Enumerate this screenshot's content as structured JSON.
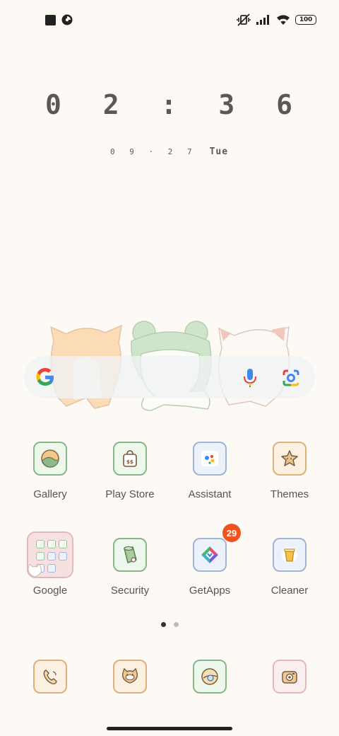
{
  "status_bar": {
    "battery_level": "100",
    "icons": [
      "notification-square-icon",
      "pie-app-icon",
      "vibrate-off-icon",
      "signal-icon",
      "wifi-icon",
      "battery-icon"
    ]
  },
  "clock": {
    "time": "0 2 : 3 6",
    "date": "0 9 · 2 7",
    "day": "Tue"
  },
  "search_bar": {
    "icons": [
      "google-logo-icon",
      "microphone-icon",
      "google-lens-icon"
    ]
  },
  "apps": [
    {
      "label": "Gallery",
      "icon": "gallery-icon",
      "border": "#88b887",
      "bg": "#eef7ec"
    },
    {
      "label": "Play Store",
      "icon": "play-store-icon",
      "border": "#88b887",
      "bg": "#eef7ec"
    },
    {
      "label": "Assistant",
      "icon": "assistant-icon",
      "border": "#9fb4d6",
      "bg": "#edf1f9"
    },
    {
      "label": "Themes",
      "icon": "themes-icon",
      "border": "#e0b07a",
      "bg": "#fbf0e2"
    },
    {
      "label": "Google",
      "icon": "google-folder-icon",
      "folder": true
    },
    {
      "label": "Security",
      "icon": "security-icon",
      "border": "#88b887",
      "bg": "#eef7ec"
    },
    {
      "label": "GetApps",
      "icon": "getapps-icon",
      "border": "#9fb4d6",
      "bg": "#edf1f9",
      "badge": "29"
    },
    {
      "label": "Cleaner",
      "icon": "cleaner-icon",
      "border": "#9fb4d6",
      "bg": "#edf1f9"
    }
  ],
  "dock": [
    {
      "icon": "phone-icon",
      "border": "#e0b07a",
      "bg": "#fbf0e2"
    },
    {
      "icon": "messages-icon",
      "border": "#e0b07a",
      "bg": "#fbf0e2"
    },
    {
      "icon": "browser-icon",
      "border": "#88b887",
      "bg": "#eef7ec"
    },
    {
      "icon": "camera-icon",
      "border": "#e5b9bb",
      "bg": "#fbeeee"
    }
  ],
  "page_indicator": {
    "pages": 2,
    "active": 0
  },
  "colors": {
    "background": "#fdf9f5",
    "badge": "#f0521e",
    "text": "#555555"
  }
}
